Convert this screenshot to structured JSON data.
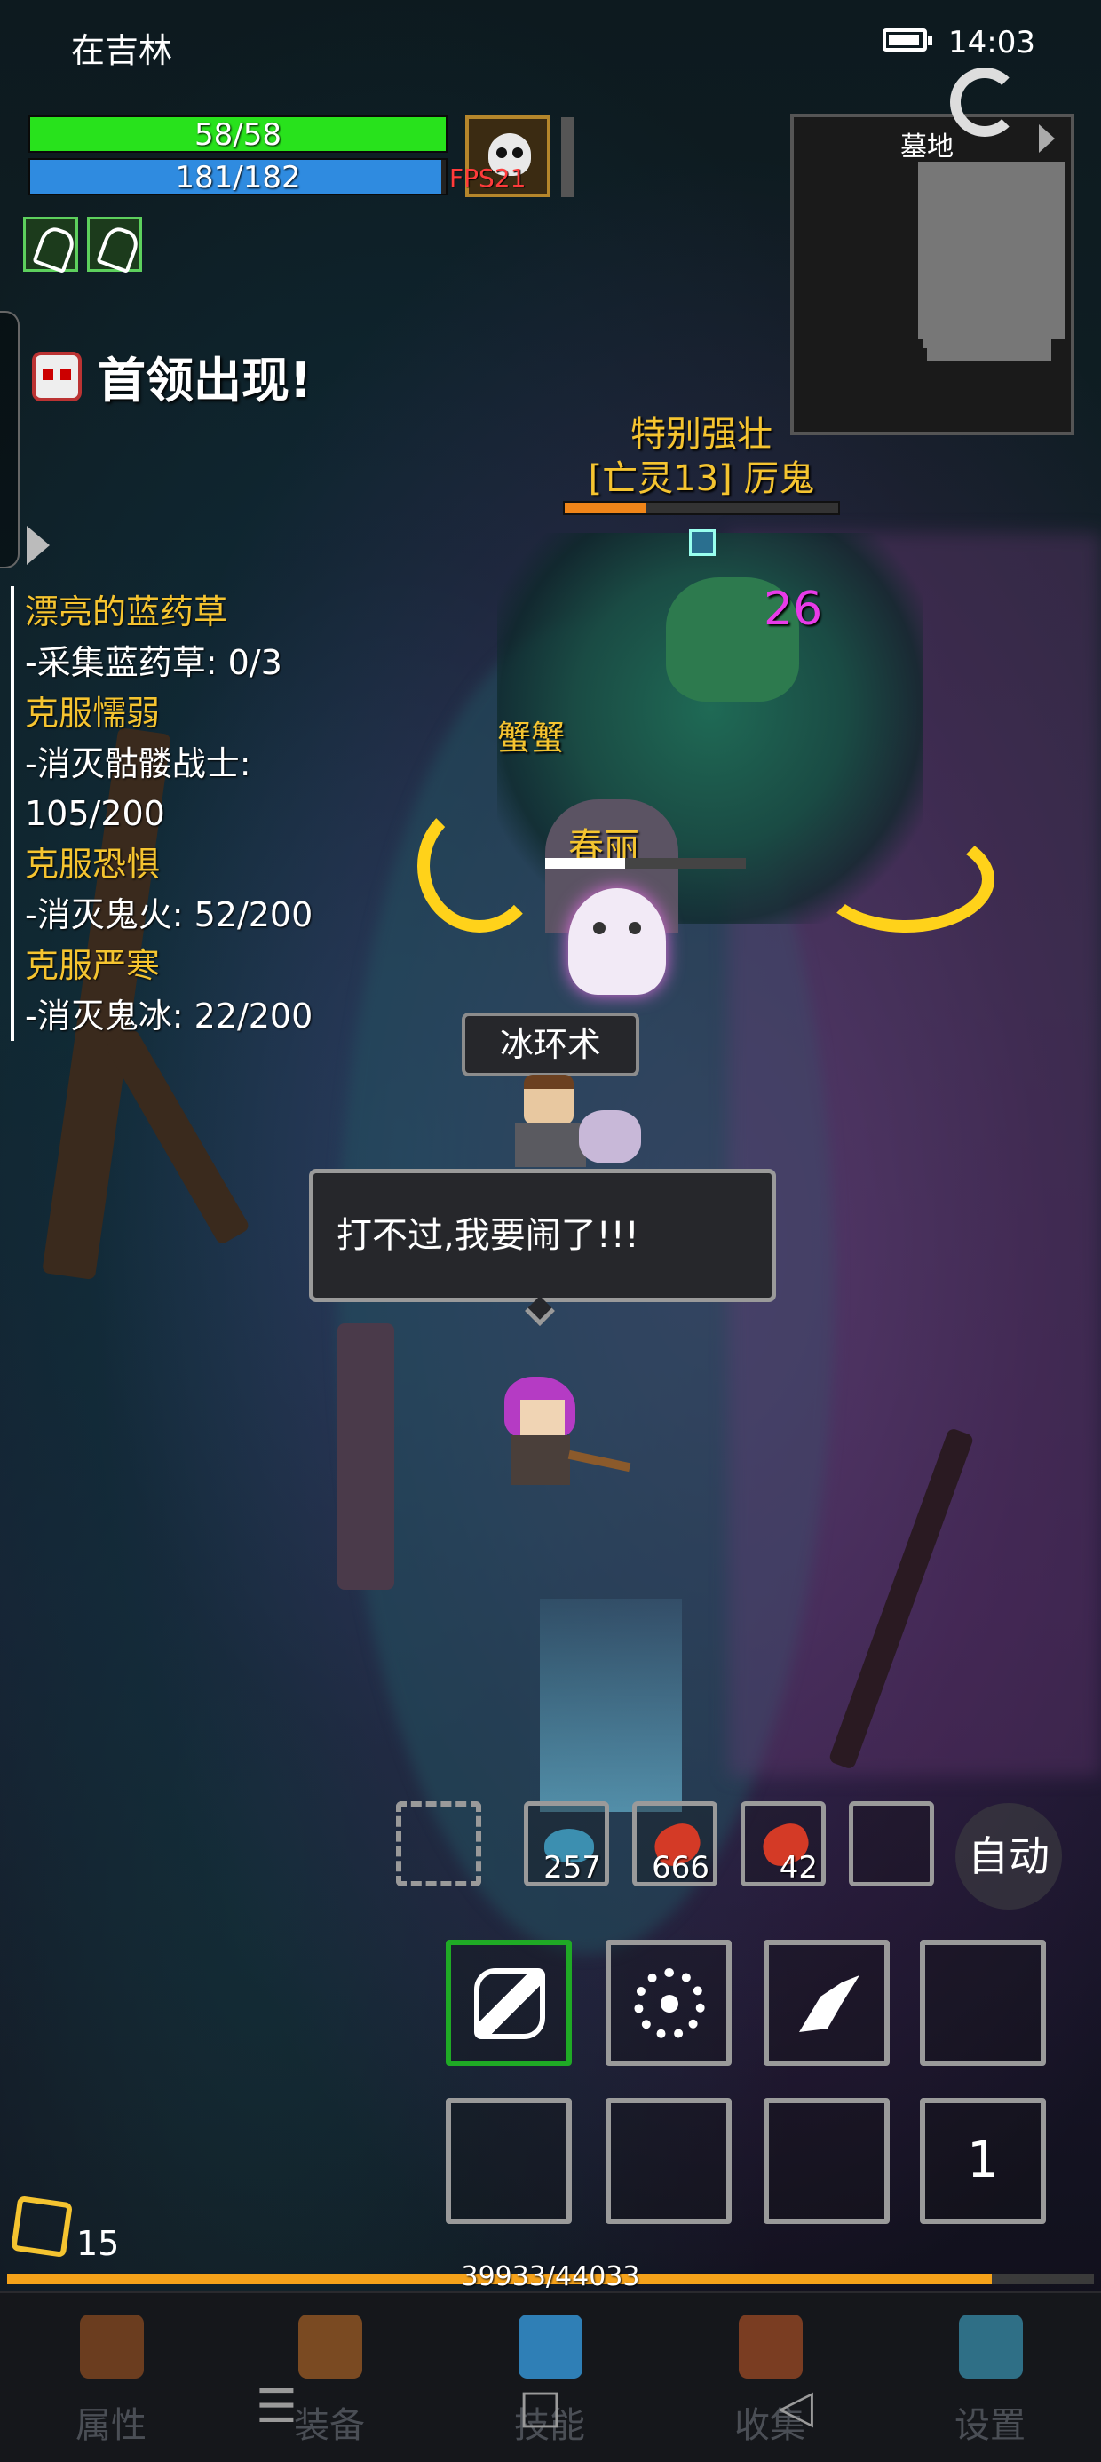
{
  "status_bar": {
    "location": "在吉林",
    "time": "14:03"
  },
  "player": {
    "hp_text": "58/58",
    "hp_fraction": 1.0,
    "mp_text": "181/182",
    "mp_fraction": 0.99,
    "fps_text": "FPS21"
  },
  "minimap": {
    "label": "墓地"
  },
  "boss_alert": {
    "text": "首领出现!"
  },
  "quests": [
    {
      "title": "漂亮的蓝药草",
      "lines": [
        "-采集蓝药草: 0/3"
      ]
    },
    {
      "title": "克服懦弱",
      "lines": [
        "-消灭骷髅战士:",
        "105/200"
      ]
    },
    {
      "title": "克服恐惧",
      "lines": [
        "-消灭鬼火: 52/200"
      ]
    },
    {
      "title": "克服严寒",
      "lines": [
        "-消灭鬼冰: 22/200"
      ]
    }
  ],
  "boss": {
    "modifier": "特别强壮",
    "name": "[亡灵13] 厉鬼",
    "hp_fraction": 0.3,
    "damage_number": "26"
  },
  "allies": {
    "name_1": "蟹蟹",
    "name_2": "春丽"
  },
  "skill_cast": "冰环术",
  "dialog": {
    "text": "打不过,我要闹了!!!"
  },
  "quickbar": {
    "items": [
      {
        "icon": "empty-slot",
        "count": ""
      },
      {
        "icon": "blue-potion-icon",
        "count": "257"
      },
      {
        "icon": "meat-icon",
        "count": "666"
      },
      {
        "icon": "meat-icon",
        "count": "42"
      },
      {
        "icon": "empty-slot",
        "count": ""
      }
    ],
    "auto_label": "自动"
  },
  "skills": {
    "row1": [
      "slash-skill-icon",
      "burst-skill-icon",
      "dash-skill-icon",
      "empty-slot"
    ],
    "row2": [
      "empty-slot",
      "empty-slot",
      "empty-slot",
      "page"
    ],
    "page_number": "1"
  },
  "level": {
    "value": "15",
    "xp_text": "39933/44033",
    "xp_fraction": 0.906
  },
  "bottom_nav": [
    {
      "label": "属性",
      "icon": "helmet-icon",
      "color": "#6b3d1f"
    },
    {
      "label": "装备",
      "icon": "bag-icon",
      "color": "#7a4a22"
    },
    {
      "label": "技能",
      "icon": "gem-icon",
      "color": "#2f7fb6"
    },
    {
      "label": "收集",
      "icon": "chest-icon",
      "color": "#7a3d22"
    },
    {
      "label": "设置",
      "icon": "gear-icon",
      "color": "#2f6f86"
    }
  ],
  "system_nav": {
    "menu": "☰",
    "home": "□",
    "back": "◁"
  }
}
